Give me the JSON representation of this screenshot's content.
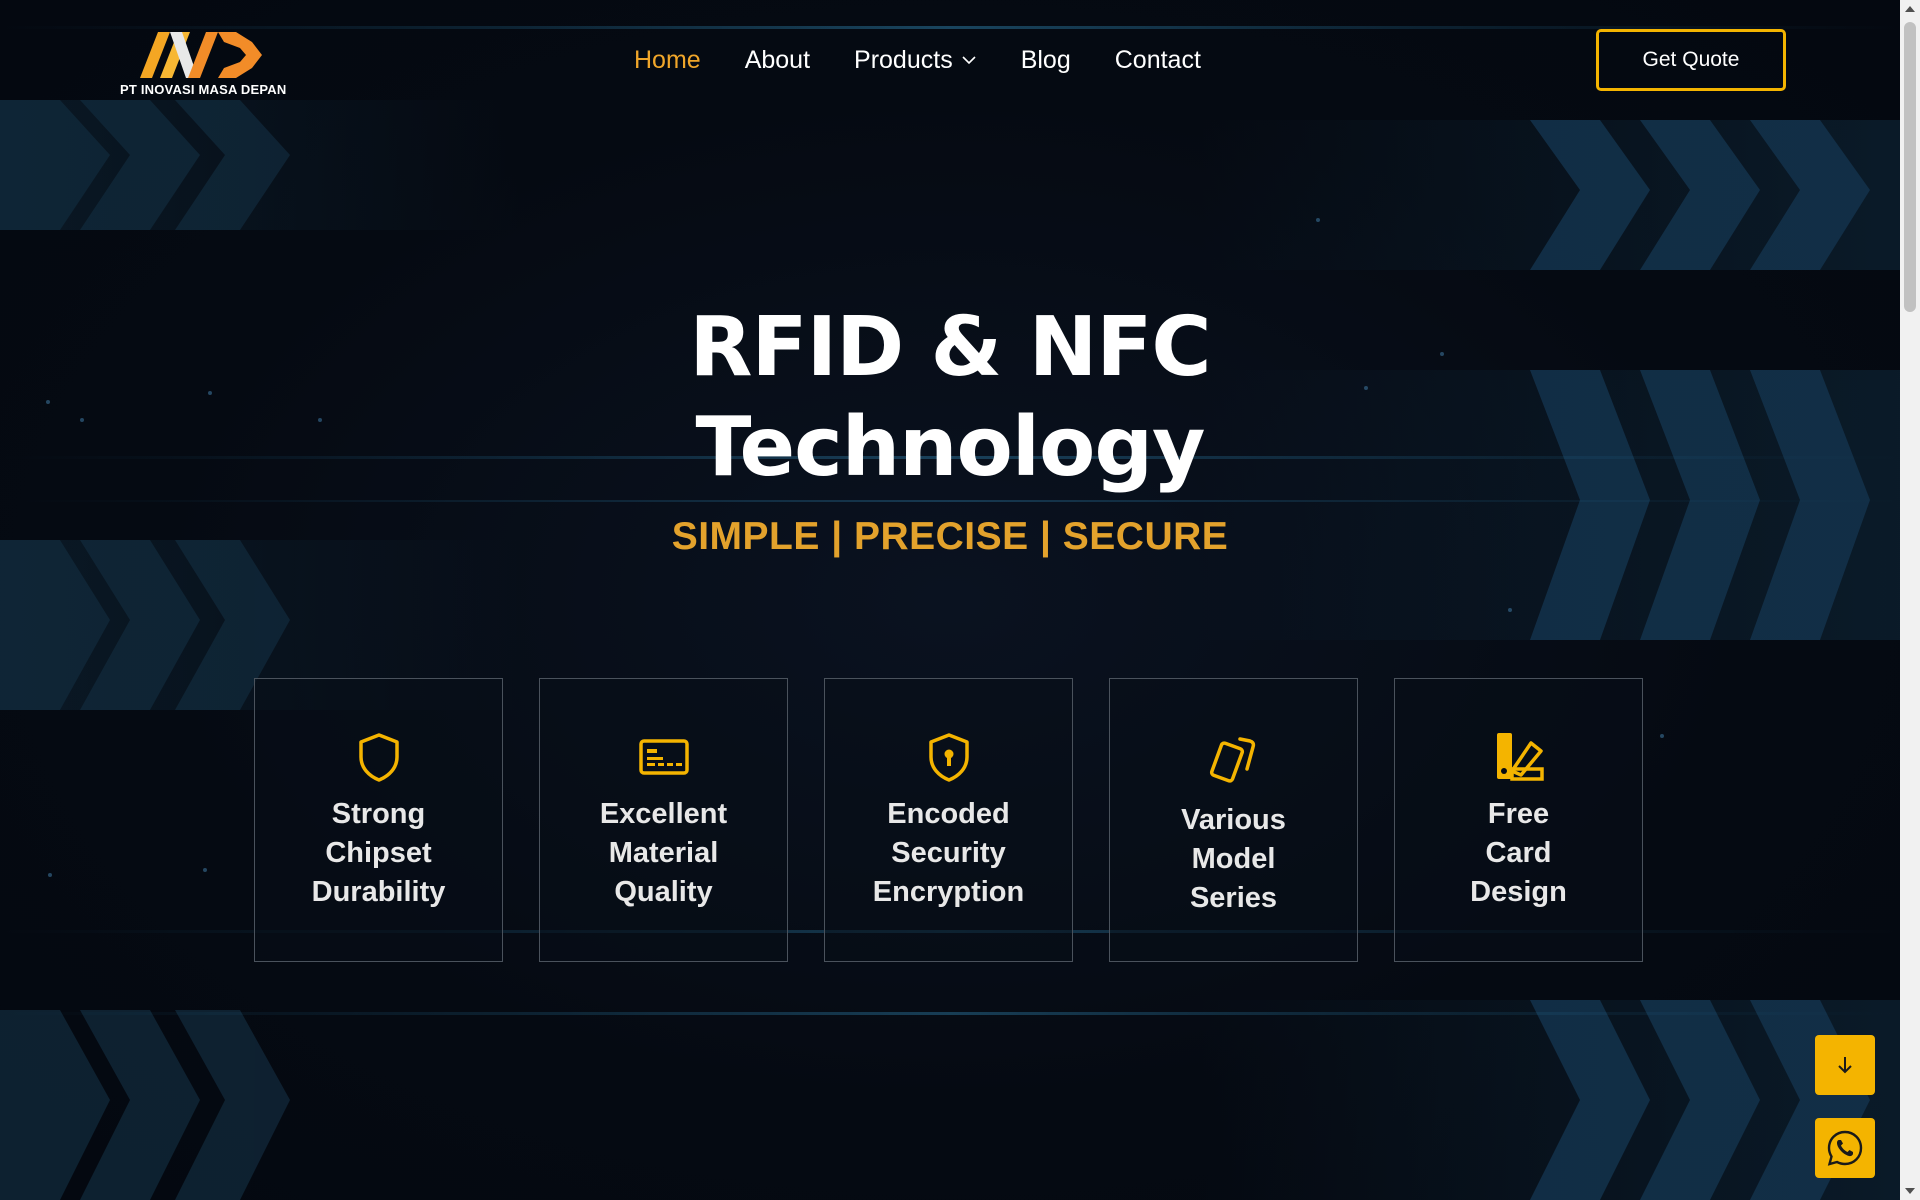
{
  "brand": {
    "name": "PT INOVASI MASA DEPAN",
    "logo_icon": "imd-logo-icon",
    "colors": {
      "accent": "#f4b400",
      "accent_text": "#e3a22c",
      "nav_active": "#f0a62a",
      "background": "#050a12"
    }
  },
  "nav": {
    "items": [
      {
        "label": "Home",
        "active": true
      },
      {
        "label": "About",
        "active": false
      },
      {
        "label": "Products",
        "active": false,
        "has_dropdown": true
      },
      {
        "label": "Blog",
        "active": false
      },
      {
        "label": "Contact",
        "active": false
      }
    ],
    "cta_label": "Get Quote"
  },
  "hero": {
    "title_line1": "RFID & NFC",
    "title_line2": "Technology",
    "tagline": "SIMPLE | PRECISE | SECURE"
  },
  "features": [
    {
      "title": "Strong\nChipset\nDurability",
      "icon": "shield-icon"
    },
    {
      "title": "Excellent\nMaterial\nQuality",
      "icon": "card-icon"
    },
    {
      "title": "Encoded\nSecurity\nEncryption",
      "icon": "shield-lock-icon"
    },
    {
      "title": "Various\nModel\nSeries",
      "icon": "cards-icon"
    },
    {
      "title": "Free\nCard\nDesign",
      "icon": "design-swatch-icon"
    }
  ],
  "floating": {
    "scroll_icon": "arrow-down-icon",
    "chat_icon": "whatsapp-icon"
  }
}
